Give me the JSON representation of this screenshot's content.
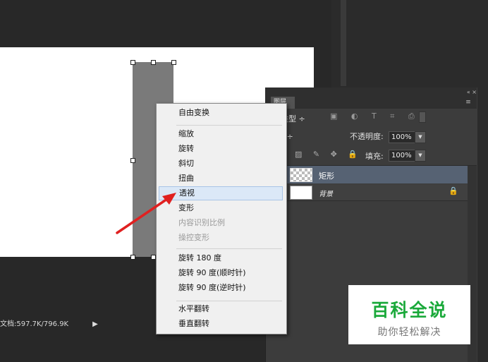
{
  "status_bar": {
    "doc_text": "文档:597.7K/796.9K",
    "arrow_icon": "play-right-icon"
  },
  "layers_panel": {
    "tab_label": "图层",
    "top_icons": "«  ×",
    "menu_icon": "≡",
    "filter_label": "类型  ÷",
    "filter_icons": "▣ ◐ T ⌗ ⎙",
    "blend_mode": "常                    ÷",
    "opacity_label": "不透明度:",
    "opacity_value": "100%",
    "lock_label": ":",
    "lock_icons": "▨ ✎ ✥ 🔒",
    "fill_label": "填充:",
    "fill_value": "100%",
    "dropdown_glyph": "▼",
    "layers": [
      {
        "name": "矩形",
        "selected": true
      },
      {
        "name": "背景",
        "locked": true,
        "lock_glyph": "🔒"
      }
    ]
  },
  "context_menu": {
    "groups": [
      [
        "自由变换"
      ],
      [
        "缩放",
        "旋转",
        "斜切",
        "扭曲",
        "透视",
        "变形",
        "内容识别比例",
        "操控变形"
      ],
      [
        "旋转 180 度",
        "旋转 90 度(顺时针)",
        "旋转 90 度(逆时针)"
      ],
      [
        "水平翻转",
        "垂直翻转"
      ]
    ],
    "highlighted": "透视",
    "disabled": [
      "内容识别比例",
      "操控变形"
    ]
  },
  "watermark": {
    "title": "百科全说",
    "subtitle": "助你轻松解决"
  },
  "colors": {
    "background": "#282828",
    "canvas": "#ffffff",
    "shape": "#7a7a7a",
    "panel": "#3c3c3c",
    "selected_layer": "#566273",
    "arrow": "#e02020",
    "watermark_green": "#1aa93a"
  }
}
